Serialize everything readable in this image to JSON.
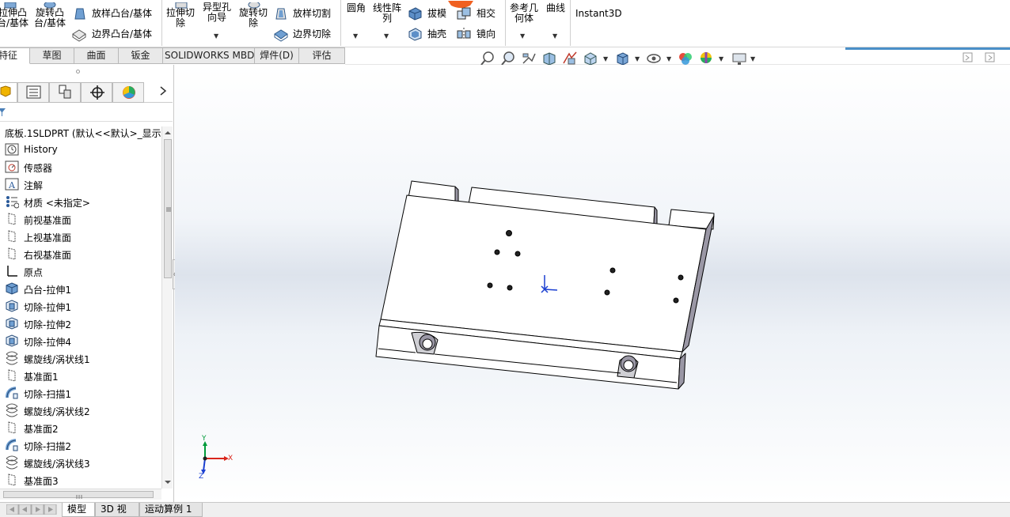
{
  "ribbon": {
    "boss_extrude": "拉伸凸\n台/基体",
    "revolve_boss": "旋转凸\n台/基体",
    "loft_boss": "放样凸台/基体",
    "boundary_boss": "边界凸台/基体",
    "extrude_cut": "拉伸切\n除",
    "hole_wizard": "异型孔\n向导",
    "revolve_cut": "旋转切\n除",
    "loft_cut": "放样切割",
    "boundary_cut": "边界切除",
    "fillet": "圆角",
    "linear_pattern": "线性阵\n列",
    "draft": "拔模",
    "intersect": "相交",
    "shell": "抽壳",
    "mirror": "镜向",
    "ref_geometry": "参考几\n何体",
    "curves": "曲线",
    "instant3d": "Instant3D"
  },
  "tabs": [
    {
      "label": "特征",
      "active": true
    },
    {
      "label": "草图",
      "active": false
    },
    {
      "label": "曲面",
      "active": false
    },
    {
      "label": "钣金",
      "active": false
    },
    {
      "label": "SOLIDWORKS MBD",
      "active": false
    },
    {
      "label": "焊件(D)",
      "active": false
    },
    {
      "label": "评估",
      "active": false
    }
  ],
  "tree": {
    "root": "底板.1SLDPRT  (默认<<默认>_显示状",
    "items": [
      {
        "label": "History",
        "icon": "history-icon"
      },
      {
        "label": "传感器",
        "icon": "sensor-icon"
      },
      {
        "label": "注解",
        "icon": "annotation-icon"
      },
      {
        "label": "材质 <未指定>",
        "icon": "material-icon"
      },
      {
        "label": "前视基准面",
        "icon": "plane-icon"
      },
      {
        "label": "上视基准面",
        "icon": "plane-icon"
      },
      {
        "label": "右视基准面",
        "icon": "plane-icon"
      },
      {
        "label": "原点",
        "icon": "origin-icon"
      },
      {
        "label": "凸台-拉伸1",
        "icon": "boss-extrude-icon"
      },
      {
        "label": "切除-拉伸1",
        "icon": "cut-extrude-icon"
      },
      {
        "label": "切除-拉伸2",
        "icon": "cut-extrude-icon"
      },
      {
        "label": "切除-拉伸4",
        "icon": "cut-extrude-icon"
      },
      {
        "label": "螺旋线/涡状线1",
        "icon": "helix-icon"
      },
      {
        "label": "基准面1",
        "icon": "plane-icon"
      },
      {
        "label": "切除-扫描1",
        "icon": "cut-sweep-icon"
      },
      {
        "label": "螺旋线/涡状线2",
        "icon": "helix-icon"
      },
      {
        "label": "基准面2",
        "icon": "plane-icon"
      },
      {
        "label": "切除-扫描2",
        "icon": "cut-sweep-icon"
      },
      {
        "label": "螺旋线/涡状线3",
        "icon": "helix-icon"
      },
      {
        "label": "基准面3",
        "icon": "plane-icon"
      }
    ]
  },
  "triad": {
    "x": "X",
    "y": "Y",
    "z": "Z"
  },
  "bottom_tabs": [
    {
      "label": "模型",
      "active": true
    },
    {
      "label": "3D 视图",
      "active": false
    },
    {
      "label": "运动算例 1",
      "active": false
    }
  ],
  "colors": {
    "accent": "#4a90c8",
    "model_face": "#ffffff",
    "model_edge": "#000000",
    "model_side": "#9a97a5"
  }
}
